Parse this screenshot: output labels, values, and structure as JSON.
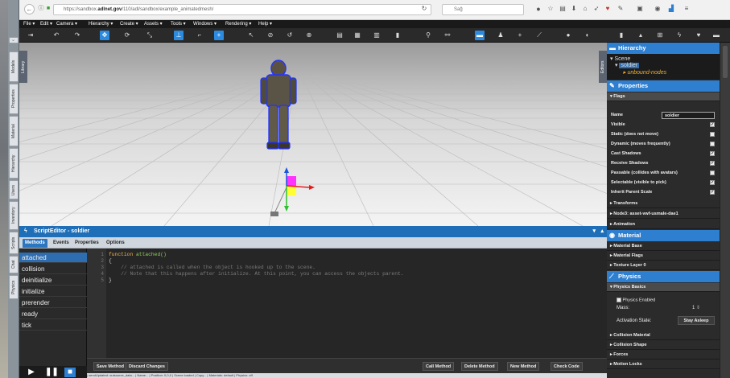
{
  "browser": {
    "url_prefix": "https://sandbox.",
    "url_domain": "adlnet.gov",
    "url_rest": "/110/adl/sandbox/example_animatedmesh/",
    "search_placeholder": "Sağ"
  },
  "side_tabs": [
    "Models",
    "Properties",
    "Material",
    "Hierarchy",
    "Users",
    "Inventory",
    "Scripts",
    "Chat",
    "Physics"
  ],
  "menubar": [
    "File ▾",
    "Edit ▾",
    "Camera ▾",
    "Hierarchy ▾",
    "Create ▾",
    "Assets ▾",
    "Tools ▾",
    "Windows ▾",
    "Rendering ▾",
    "Help ▾"
  ],
  "viewport": {
    "left_tab": "Library",
    "right_tab": "Editors"
  },
  "script_editor": {
    "title": "ScriptEditor - soldier",
    "tabs": [
      "Methods",
      "Events",
      "Properties",
      "Options"
    ],
    "methods": [
      "attached",
      "collision",
      "deinitialize",
      "initialize",
      "prerender",
      "ready",
      "tick"
    ],
    "selected_method": "attached",
    "line_numbers": [
      "1",
      "2",
      "3",
      "4",
      "5"
    ],
    "code": {
      "line1_kw": "function",
      "line1_fn": " attached()",
      "line2": "{",
      "line3": "    // attached is called when the object is hooked up to the scene.",
      "line4": "    // Note that this happens after initialize. At this point, you can access the objects parent.",
      "line5": "}"
    },
    "footer_left": [
      "Save Method",
      "Discard Changes"
    ],
    "footer_right": [
      "Call Method",
      "Delete Method",
      "New Method",
      "Check Code"
    ],
    "status": "|   sendUpdated: outsource_data...   |   Name...   |   Position: 0,0,0   |   Scene loaded   |   Copy...   |   Materials: default   |   Physics: off"
  },
  "hierarchy": {
    "title": "Hierarchy",
    "scene": "Scene",
    "selected": "soldier",
    "child": "unbound-nodes"
  },
  "properties": {
    "title": "Properties",
    "flags_label": "Flags",
    "name_label": "Name",
    "name_value": "soldier",
    "flags": [
      {
        "label": "Visible",
        "checked": true
      },
      {
        "label": "Static (does not move)",
        "checked": false
      },
      {
        "label": "Dynamic (moves frequently)",
        "checked": false
      },
      {
        "label": "Cast Shadows",
        "checked": true
      },
      {
        "label": "Receive Shadows",
        "checked": true
      },
      {
        "label": "Passable (collides with avatars)",
        "checked": false
      },
      {
        "label": "Selectable (visible to pick)",
        "checked": true
      },
      {
        "label": "Inherit Parent Scale",
        "checked": true
      }
    ],
    "sections": [
      "Transforms",
      "Node3: asset-vwf-usmale-dae1",
      "Animation"
    ]
  },
  "material": {
    "title": "Material",
    "sections": [
      "Material Base",
      "Material Flags",
      "Texture Layer 0"
    ]
  },
  "physics": {
    "title": "Physics",
    "basics": "Physics Basics",
    "enabled_label": "Physics Enabled",
    "mass_label": "Mass:",
    "mass_value": "1",
    "activation_label": "Activation State:",
    "activation_value": "Stay Asleep",
    "sections": [
      "Collision Material",
      "Collision Shape",
      "Forces",
      "Motion Locks"
    ]
  },
  "colors": {
    "accent": "#2e7fd0",
    "panel_dark": "#2b2b2b",
    "selection": "#2d6db0"
  }
}
